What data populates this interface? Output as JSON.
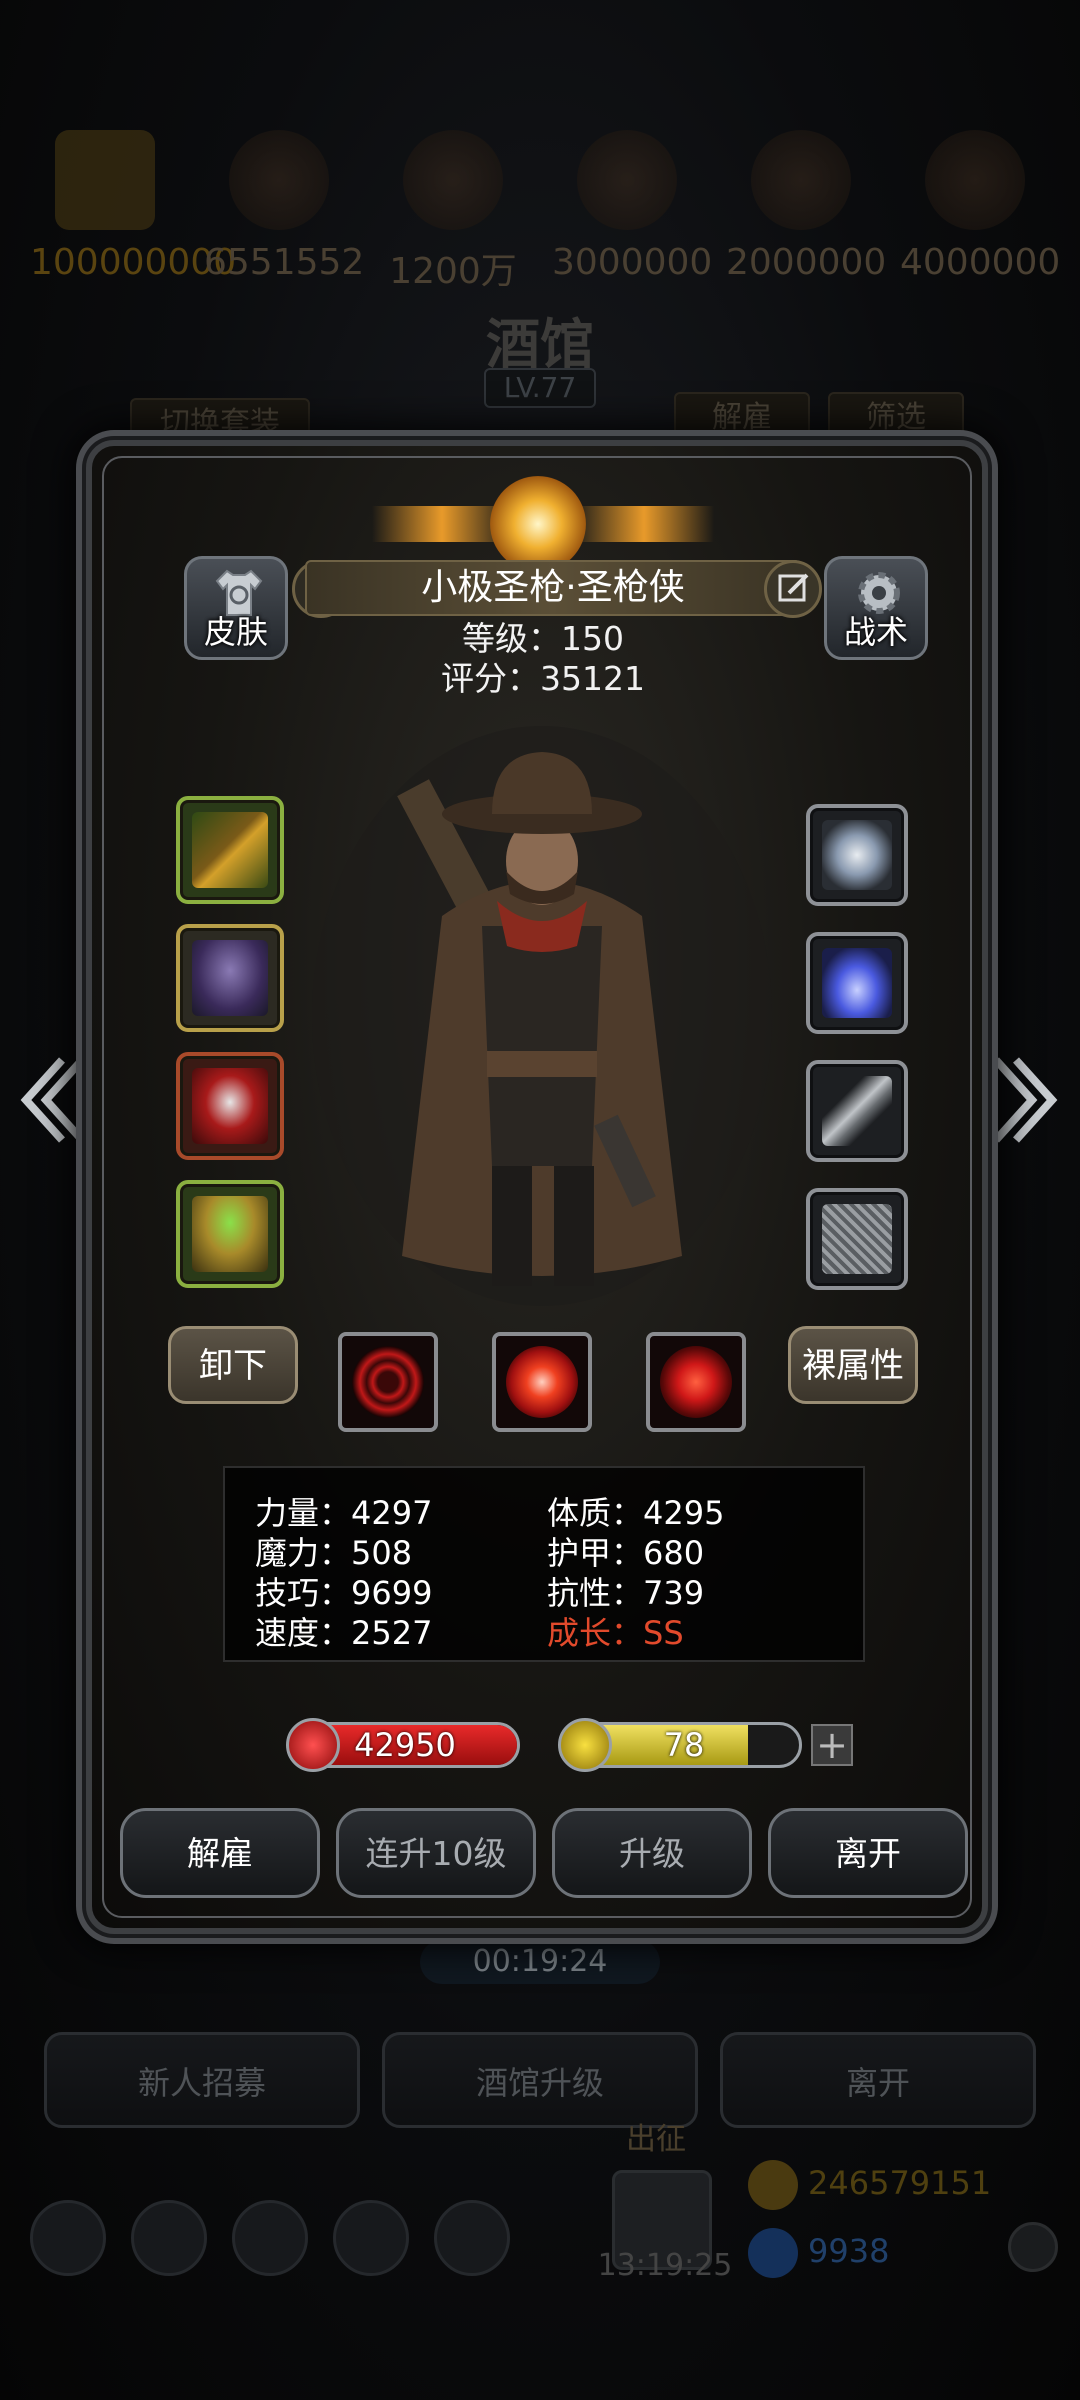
{
  "background": {
    "resources": [
      "100000000",
      "6551552",
      "1200万",
      "3000000",
      "2000000",
      "4000000"
    ],
    "title": "酒馆",
    "level": "LV.77",
    "switch_outfit": "切换套装",
    "dismiss": "解雇",
    "filter": "筛选",
    "timer": "00:19:24",
    "bottom_buttons": [
      "新人招募",
      "酒馆升级",
      "离开"
    ],
    "expedition_label": "出征",
    "gift_timer": "13:19:25",
    "gold": "246579151",
    "diamonds": "9938"
  },
  "hero": {
    "name": "小极圣枪·圣枪侠",
    "level_text": "等级：150",
    "score_text": "评分：35121"
  },
  "buttons": {
    "skin": "皮肤",
    "tactics": "战术",
    "unequip": "卸下",
    "base_attributes": "裸属性"
  },
  "stats": {
    "strength": "力量：4297",
    "magic": "魔力：508",
    "skill": "技巧：9699",
    "speed": "速度：2527",
    "constitution": "体质：4295",
    "armor": "护甲：680",
    "resistance": "抗性：739",
    "growth": "成长：SS"
  },
  "bars": {
    "hp": "42950",
    "hp_fill": 1.0,
    "energy": "78",
    "energy_fill": 0.78
  },
  "actions": [
    "解雇",
    "连升10级",
    "升级",
    "离开"
  ],
  "colors": {
    "growth": "#e24a2c",
    "hp": "#c8141c",
    "energy": "#d8c62e"
  }
}
